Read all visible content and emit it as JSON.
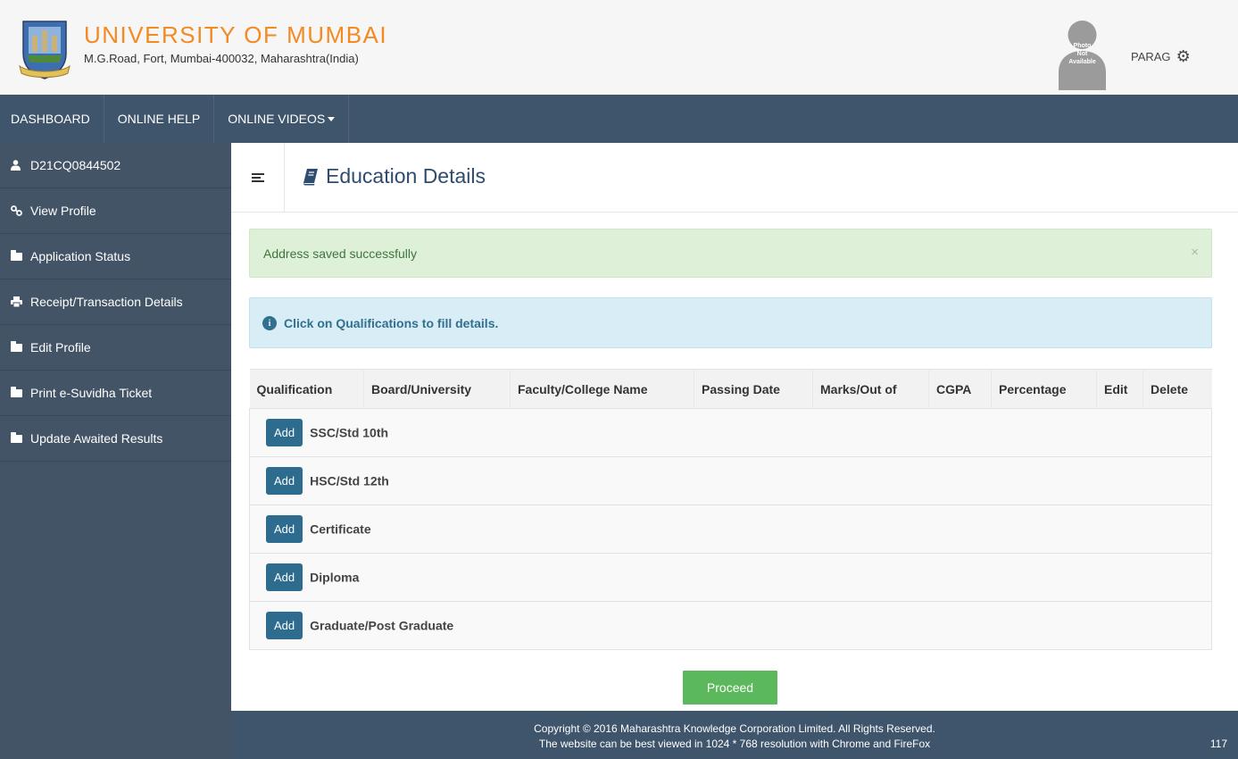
{
  "header": {
    "title": "UNIVERSITY OF MUMBAI",
    "address": "M.G.Road, Fort, Mumbai-400032, Maharashtra(India)",
    "photo_text_1": "Photo",
    "photo_text_2": "Not",
    "photo_text_3": "Available",
    "username": "PARAG"
  },
  "topnav": {
    "dashboard": "DASHBOARD",
    "online_help": "ONLINE HELP",
    "online_videos": "ONLINE VIDEOS"
  },
  "sidebar": {
    "items": [
      {
        "label": "D21CQ0844502",
        "icon": "user-icon"
      },
      {
        "label": "View Profile",
        "icon": "link-icon"
      },
      {
        "label": "Application Status",
        "icon": "folder-icon"
      },
      {
        "label": "Receipt/Transaction Details",
        "icon": "print-icon"
      },
      {
        "label": "Edit Profile",
        "icon": "folder-icon"
      },
      {
        "label": "Print e-Suvidha Ticket",
        "icon": "folder-icon"
      },
      {
        "label": "Update Awaited Results",
        "icon": "folder-icon"
      }
    ]
  },
  "main": {
    "page_title": "Education Details",
    "success_message": "Address saved successfully",
    "close_symbol": "×",
    "info_message": "Click on Qualifications to fill details.",
    "info_symbol": "i"
  },
  "table": {
    "headers": [
      "Qualification",
      "Board/University",
      "Faculty/College Name",
      "Passing Date",
      "Marks/Out of",
      "CGPA",
      "Percentage",
      "Edit",
      "Delete"
    ],
    "add_label": "Add",
    "rows": [
      {
        "qualification": "SSC/Std 10th"
      },
      {
        "qualification": "HSC/Std 12th"
      },
      {
        "qualification": "Certificate"
      },
      {
        "qualification": "Diploma"
      },
      {
        "qualification": "Graduate/Post Graduate"
      }
    ]
  },
  "proceed_label": "Proceed",
  "footer": {
    "copyright": "Copyright © 2016 Maharashtra Knowledge Corporation Limited. All Rights Reserved.",
    "note": "The website can be best viewed in 1024 * 768 resolution with Chrome and FireFox",
    "count": "117"
  },
  "colors": {
    "brand_orange": "#f38a22",
    "nav_bg": "#3f556c",
    "sidebar_bg": "#435466",
    "add_button": "#2d6b8f",
    "proceed_button": "#5cb85c"
  }
}
